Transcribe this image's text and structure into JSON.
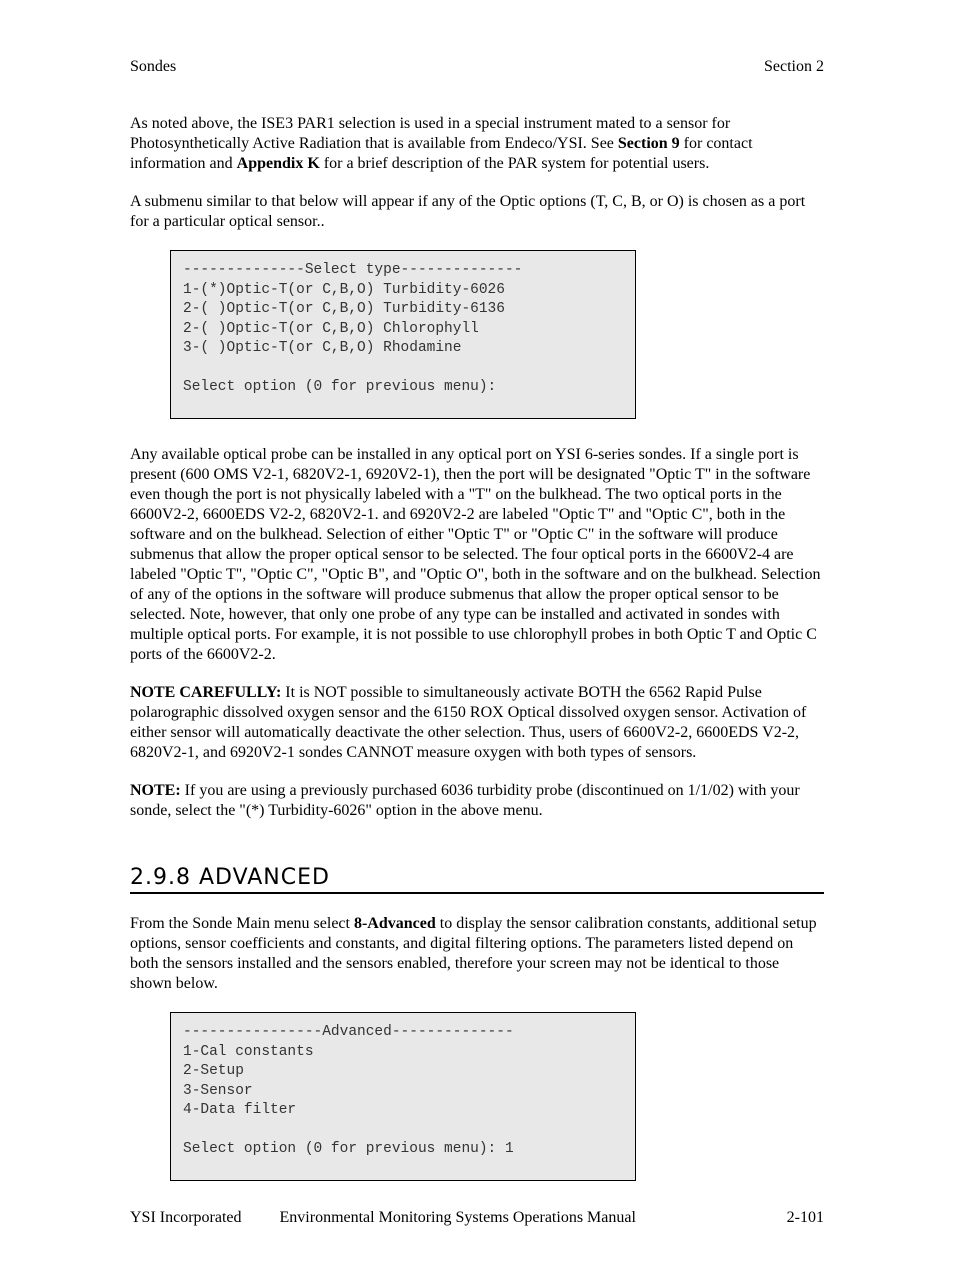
{
  "header": {
    "left": "Sondes",
    "right": "Section 2"
  },
  "para1_a": "As noted above, the ISE3 PAR1 selection is used in a special instrument mated to a sensor for Photosynthetically Active Radiation that is available from Endeco/YSI.  See ",
  "para1_b_bold": "Section 9",
  "para1_c": " for contact information and ",
  "para1_d_bold": "Appendix K",
  "para1_e": " for a brief description of the PAR system for potential users.",
  "para2": "A submenu similar to that below will appear if any of the Optic options (T, C, B, or O) is chosen as a port for a particular optical sensor..",
  "terminal1": {
    "title": "--------------Select type--------------",
    "lines": [
      "1-(*)Optic-T(or C,B,O) Turbidity-6026",
      "2-( )Optic-T(or C,B,O) Turbidity-6136",
      "2-( )Optic-T(or C,B,O) Chlorophyll",
      "3-( )Optic-T(or C,B,O) Rhodamine"
    ],
    "prompt": "Select option (0 for previous menu):"
  },
  "para3": "Any available optical probe can be installed in any optical port on YSI 6-series sondes.  If a single port is present (600 OMS V2-1, 6820V2-1, 6920V2-1), then the port will be designated \"Optic T\" in the software even though the port is not physically labeled with a \"T\" on the bulkhead. The two optical ports in the 6600V2-2, 6600EDS V2-2, 6820V2-1. and 6920V2-2 are labeled \"Optic T\" and \"Optic C\", both in the software and on the bulkhead.   Selection of either \"Optic T\" or \"Optic C\" in the software will produce submenus that allow the proper optical sensor to be selected.  The four optical ports in the 6600V2-4 are labeled \"Optic T\", \"Optic C\", \"Optic B\", and \"Optic O\", both in the software and on the bulkhead.   Selection of any of the options in the software will produce submenus that allow the proper optical sensor to be selected. Note, however, that only one probe of any type can be installed and activated in sondes with multiple optical ports.  For example, it is not possible to use chlorophyll probes in both Optic T and Optic C ports of the 6600V2-2.",
  "para4_bold": "NOTE CAREFULLY:",
  "para4_rest": " It is NOT possible to simultaneously activate BOTH the 6562 Rapid Pulse polarographic dissolved oxygen sensor and the 6150 ROX Optical dissolved oxygen sensor.   Activation of either sensor will automatically deactivate the other selection.   Thus, users of 6600V2-2, 6600EDS V2-2, 6820V2-1, and 6920V2-1 sondes CANNOT measure oxygen with both types of sensors.",
  "para5_bold": "NOTE:",
  "para5_rest": " If you are using a previously purchased 6036 turbidity probe (discontinued on 1/1/02) with your sonde, select the \"(*) Turbidity-6026\" option in the above menu.",
  "section_heading": "2.9.8 ADVANCED",
  "para6_a": "From the Sonde Main menu select ",
  "para6_bold": "8-Advanced",
  "para6_b": " to display the sensor calibration constants, additional setup options, sensor coefficients and constants, and digital filtering options. The parameters listed depend on both the sensors installed and the sensors enabled, therefore your screen may not be identical to those shown below.",
  "terminal2": {
    "title": "----------------Advanced--------------",
    "lines": [
      "1-Cal constants",
      "2-Setup",
      "3-Sensor",
      "4-Data filter"
    ],
    "prompt": "Select option (0 for previous menu): 1"
  },
  "footer": {
    "left": "YSI Incorporated",
    "mid": "Environmental Monitoring Systems Operations Manual",
    "right": "2-101"
  }
}
